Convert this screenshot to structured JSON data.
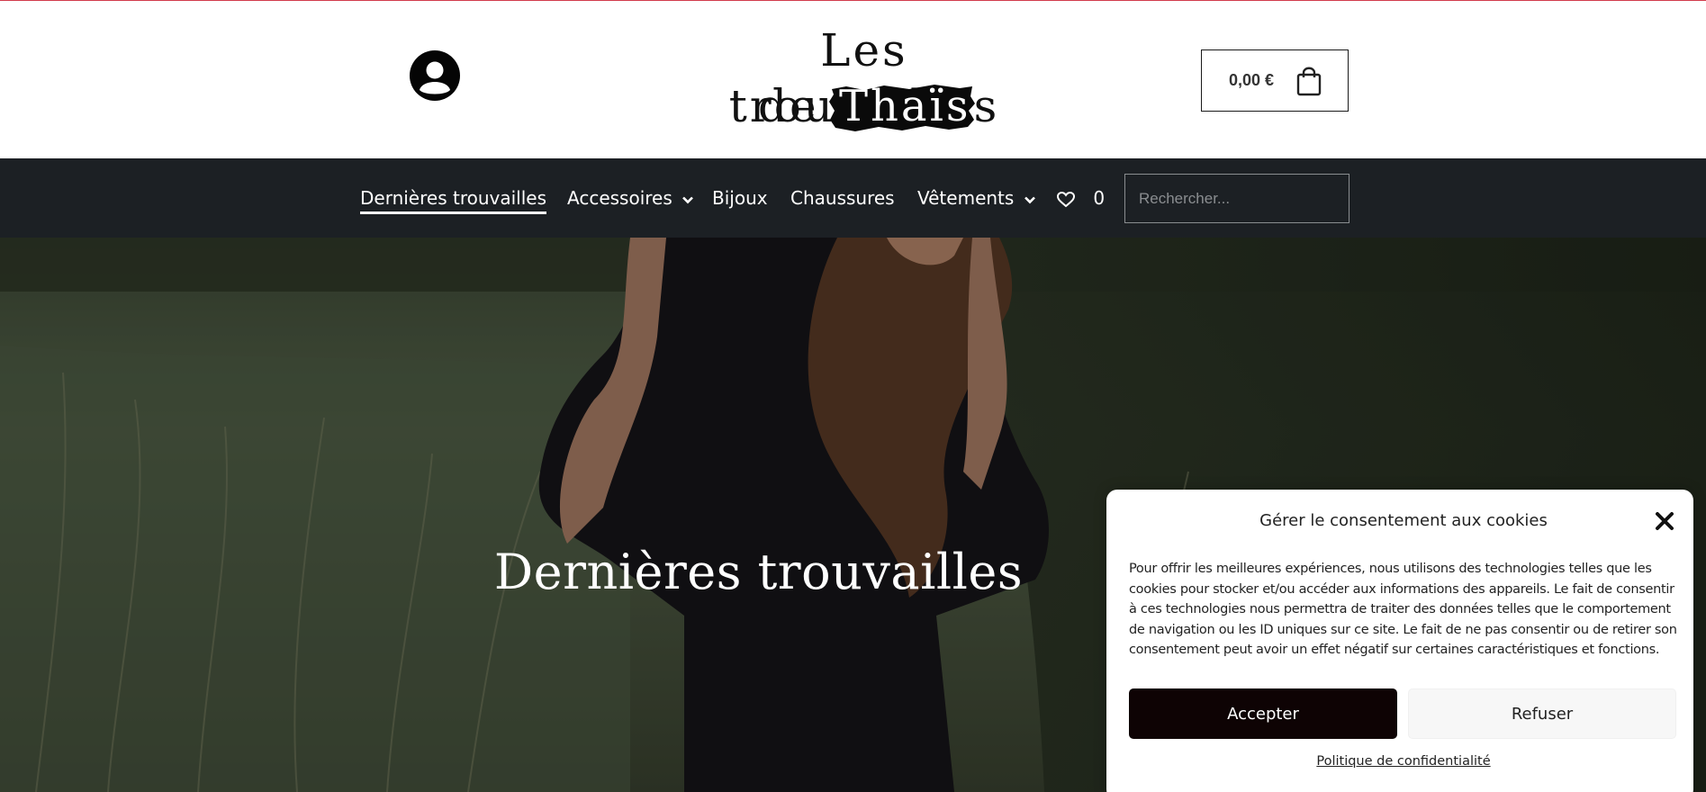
{
  "header": {
    "account_icon": "user-circle-icon",
    "logo": {
      "line1": "Les trouvailles",
      "line2_prefix": "de",
      "line2_brand": "Thaïs"
    },
    "cart": {
      "amount": "0,00 €",
      "icon": "shopping-bag-icon"
    }
  },
  "nav": {
    "items": [
      {
        "label": "Dernières trouvailles",
        "active": true,
        "has_dropdown": false
      },
      {
        "label": "Accessoires",
        "active": false,
        "has_dropdown": true
      },
      {
        "label": "Bijoux",
        "active": false,
        "has_dropdown": false
      },
      {
        "label": "Chaussures",
        "active": false,
        "has_dropdown": false
      },
      {
        "label": "Vêtements",
        "active": false,
        "has_dropdown": true
      }
    ],
    "wishlist": {
      "icon": "heart-icon",
      "count": "0"
    },
    "search": {
      "placeholder": "Rechercher..."
    }
  },
  "hero": {
    "title": "Dernières trouvailles"
  },
  "cookie_dialog": {
    "title": "Gérer le consentement aux cookies",
    "body": "Pour offrir les meilleures expériences, nous utilisons des technologies telles que les cookies pour stocker et/ou accéder aux informations des appareils. Le fait de consentir à ces technologies nous permettra de traiter des données telles que le comportement de navigation ou les ID uniques sur ce site. Le fait de ne pas consentir ou de retirer son consentement peut avoir un effet négatif sur certaines caractéristiques et fonctions.",
    "accept_label": "Accepter",
    "refuse_label": "Refuser",
    "policy_label": "Politique de confidentialité"
  },
  "colors": {
    "nav_bg": "#1c2024",
    "accept_bg": "#0e0304",
    "refuse_bg": "#f7f7f7",
    "top_accent": "#d23c4d"
  }
}
